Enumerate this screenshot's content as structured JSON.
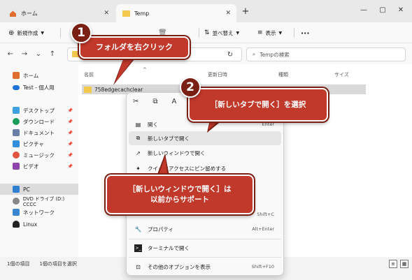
{
  "tabs": [
    {
      "label": "ホーム",
      "close": "✕"
    },
    {
      "label": "Temp",
      "close": "✕"
    }
  ],
  "new_tab": "+",
  "window_controls": [
    "—",
    "▢",
    "✕"
  ],
  "toolbar": {
    "new_label": "新規作成",
    "sort_label": "並べ替え",
    "view_label": "表示",
    "more": "···"
  },
  "search": {
    "placeholder": "Tempの検索"
  },
  "sidebar": {
    "items": [
      {
        "label": "ホーム",
        "pinned": false
      },
      {
        "label": "Test - 個人用",
        "pinned": false
      },
      {
        "label": "デスクトップ",
        "pinned": true
      },
      {
        "label": "ダウンロード",
        "pinned": true
      },
      {
        "label": "ドキュメント",
        "pinned": true
      },
      {
        "label": "ピクチャ",
        "pinned": true
      },
      {
        "label": "ミュージック",
        "pinned": true
      },
      {
        "label": "ビデオ",
        "pinned": true
      },
      {
        "label": "PC",
        "pinned": false
      },
      {
        "label": "DVD ドライブ (D:) CCCC",
        "pinned": false
      },
      {
        "label": "ネットワーク",
        "pinned": false
      },
      {
        "label": "Linux",
        "pinned": false
      }
    ]
  },
  "columns": [
    "名前",
    "更新日時",
    "種類",
    "サイズ"
  ],
  "files": [
    {
      "name": "758edgecachclear"
    }
  ],
  "status": {
    "count": "1個の項目",
    "selected": "1個の項目を選択"
  },
  "context_menu": {
    "items": [
      {
        "label": "開く",
        "shortcut": "Enter"
      },
      {
        "label": "新しいタブで開く",
        "shortcut": ""
      },
      {
        "label": "新しいウィンドウで開く",
        "shortcut": ""
      },
      {
        "label": "クイックアクセスにピン留めする",
        "shortcut": ""
      },
      {
        "label": "",
        "shortcut": "Shift+C"
      },
      {
        "label": "プロパティ",
        "shortcut": "Alt+Enter"
      },
      {
        "label": "ターミナルで開く",
        "shortcut": ""
      },
      {
        "label": "その他のオプションを表示",
        "shortcut": "Shift+F10"
      }
    ]
  },
  "callouts": {
    "step1_num": "1",
    "step1_text": "フォルダを右クリック",
    "step2_num": "2",
    "step2_text": "［新しいタブで開く］を選択",
    "note_text": "［新しいウィンドウで開く］は\n以前からサポート"
  },
  "colors": {
    "callout_red": "#c0392b",
    "badge_dark": "#7a1f14",
    "folder_yellow": "#f2c94c"
  }
}
